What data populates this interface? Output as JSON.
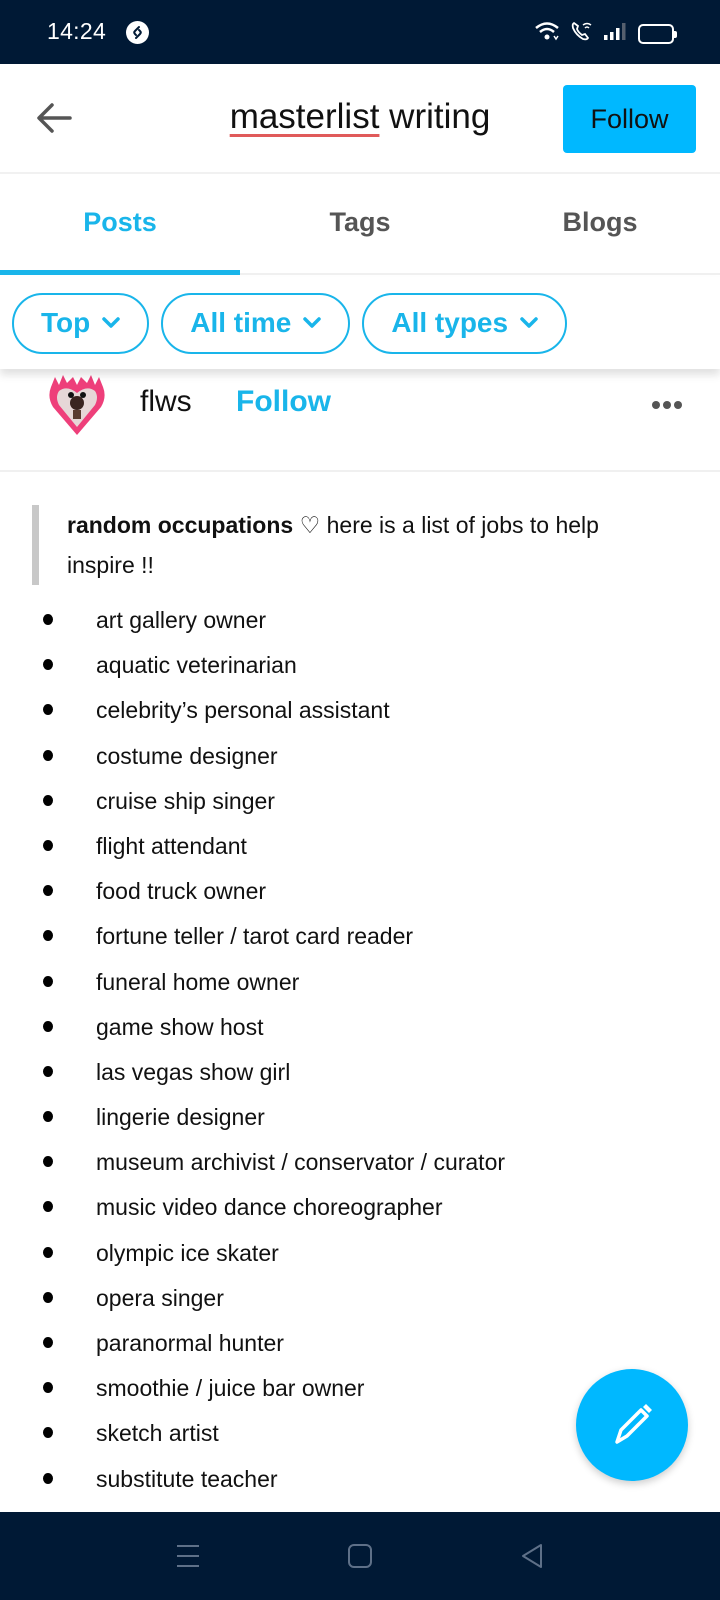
{
  "status_bar": {
    "time": "14:24",
    "app_icon": "shazam-icon",
    "icons": [
      "wifi-icon",
      "wifi-calling-icon",
      "signal-icon",
      "battery-icon"
    ]
  },
  "header": {
    "back_icon": "arrow-left-icon",
    "title_misspelled_word": "masterlist",
    "title_rest": " writing",
    "follow_label": "Follow",
    "accent_color": "#00b8ff"
  },
  "tabs": [
    {
      "label": "Posts",
      "active": true
    },
    {
      "label": "Tags",
      "active": false
    },
    {
      "label": "Blogs",
      "active": false
    }
  ],
  "filters": [
    {
      "label": "Top",
      "icon": "chevron-down-icon"
    },
    {
      "label": "All time",
      "icon": "chevron-down-icon"
    },
    {
      "label": "All types",
      "icon": "chevron-down-icon"
    }
  ],
  "post": {
    "blog_name": "flws",
    "follow_label": "Follow",
    "more_icon": "more-horizontal-icon",
    "quote_bold": "random occupations",
    "quote_symbol": " ♡ ",
    "quote_text": " here is a list of jobs to help inspire !!",
    "items": [
      "art gallery owner",
      "aquatic veterinarian",
      "celebrity’s personal assistant",
      "costume designer",
      "cruise ship singer",
      "flight attendant",
      "food truck owner",
      "fortune teller / tarot card reader",
      "funeral home owner",
      "game show host",
      "las vegas show girl",
      "lingerie designer",
      "museum archivist / conservator / curator",
      "music video dance choreographer",
      "olympic ice skater",
      "opera singer",
      "paranormal hunter",
      "smoothie / juice bar owner",
      "sketch artist",
      "substitute teacher"
    ]
  },
  "fab": {
    "icon": "pencil-icon"
  },
  "nav_bar": {
    "icons": [
      "menu-icon",
      "home-square-icon",
      "back-triangle-icon"
    ]
  }
}
